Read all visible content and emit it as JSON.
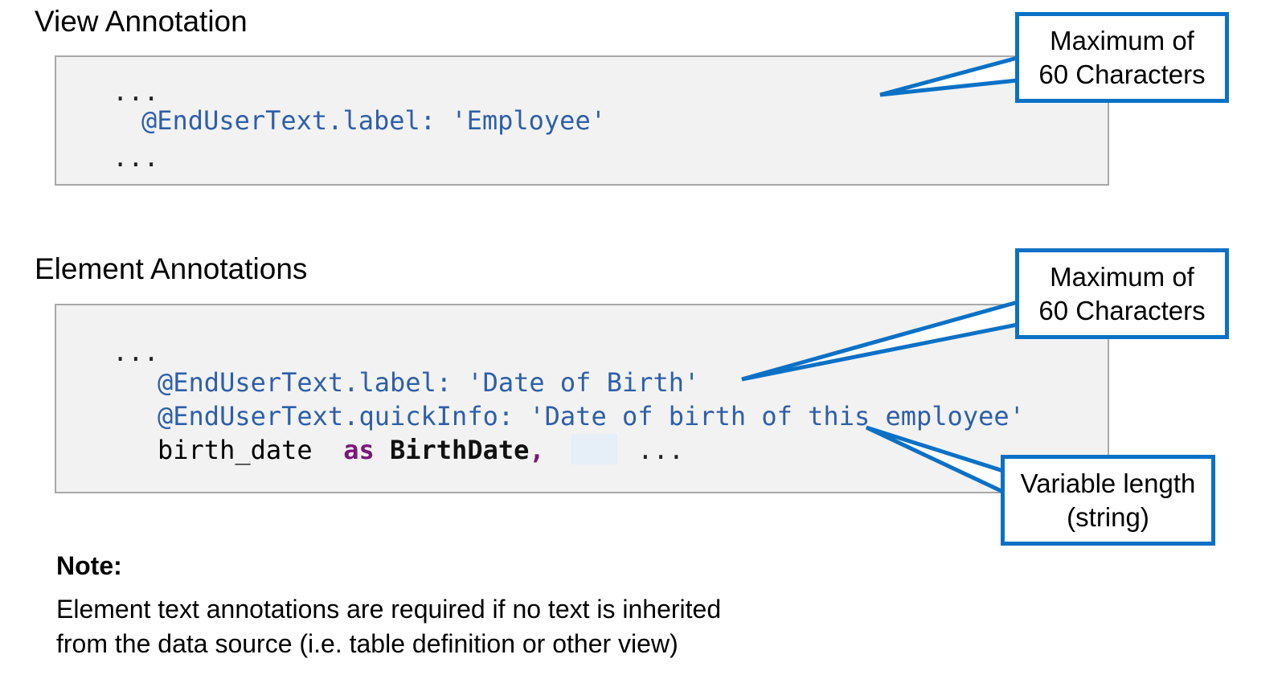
{
  "view_section": {
    "heading": "View Annotation",
    "code": {
      "line1": "...",
      "line2": "@EndUserText.label: 'Employee'",
      "line3": "..."
    },
    "callout": {
      "line1": "Maximum of",
      "line2": "60 Characters"
    }
  },
  "element_section": {
    "heading": "Element Annotations",
    "code": {
      "line1": "...",
      "line2": "@EndUserText.label: 'Date of Birth'",
      "line3": "@EndUserText.quickInfo: 'Date of birth of this employee'",
      "line4_field": "birth_date",
      "line4_keyword": "as",
      "line4_alias": "BirthDate",
      "line4_comma": ",",
      "line4_dots": "..."
    },
    "callout_max": {
      "line1": "Maximum of",
      "line2": "60 Characters"
    },
    "callout_var": {
      "line1": "Variable length",
      "line2": "(string)"
    }
  },
  "note": {
    "title": "Note:",
    "line1": "Element text annotations are required if no text is inherited",
    "line2": "from the data source (i.e. table definition or other view)"
  },
  "colors": {
    "callout_border": "#0a71c6",
    "annotation_text": "#2e5fa8",
    "keyword": "#7a1878",
    "code_background": "#f2f2f2"
  }
}
